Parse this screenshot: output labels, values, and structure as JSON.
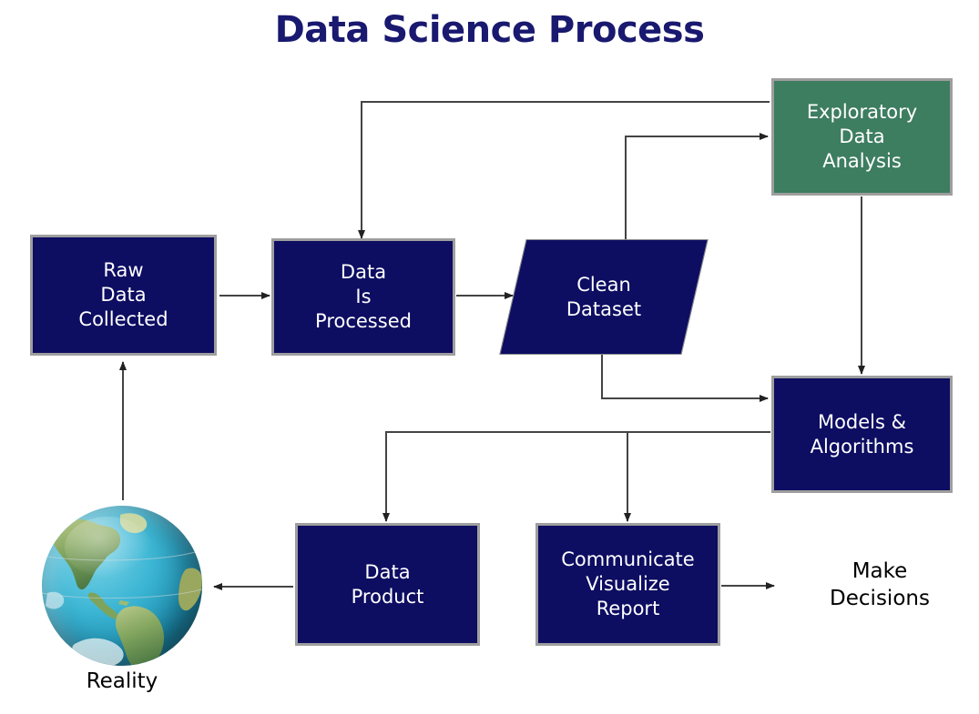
{
  "title": "Data Science Process",
  "colors": {
    "title": "#191970",
    "node_fill": "#0d0d62",
    "node_border": "#9e9e9e",
    "eda_fill": "#3d7d60",
    "text": "#ffffff",
    "plain_text": "#000000",
    "connector": "#333333",
    "background": "#ffffff"
  },
  "nodes": {
    "raw_data": {
      "lines": [
        "Raw",
        "Data",
        "Collected"
      ],
      "shape": "rectangle",
      "fill": "navy"
    },
    "data_processed": {
      "lines": [
        "Data",
        "Is",
        "Processed"
      ],
      "shape": "rectangle",
      "fill": "navy"
    },
    "clean_dataset": {
      "lines": [
        "Clean",
        "Dataset"
      ],
      "shape": "parallelogram",
      "fill": "navy"
    },
    "eda": {
      "lines": [
        "Exploratory",
        "Data",
        "Analysis"
      ],
      "shape": "rectangle",
      "fill": "green"
    },
    "models": {
      "lines": [
        "Models &",
        "Algorithms"
      ],
      "shape": "rectangle",
      "fill": "navy"
    },
    "data_product": {
      "lines": [
        "Data",
        "Product"
      ],
      "shape": "rectangle",
      "fill": "navy"
    },
    "communicate": {
      "lines": [
        "Communicate",
        "Visualize",
        "Report"
      ],
      "shape": "rectangle",
      "fill": "navy"
    },
    "make_decisions": {
      "lines": [
        "Make",
        "Decisions"
      ],
      "shape": "text",
      "fill": "none"
    },
    "reality": {
      "label": "Reality",
      "shape": "image",
      "icon": "globe-earth-icon"
    }
  },
  "edges": [
    {
      "from": "raw_data",
      "to": "data_processed",
      "label": ""
    },
    {
      "from": "data_processed",
      "to": "clean_dataset",
      "label": ""
    },
    {
      "from": "clean_dataset",
      "to": "eda",
      "label": ""
    },
    {
      "from": "eda",
      "to": "data_processed",
      "label": ""
    },
    {
      "from": "eda",
      "to": "models",
      "label": ""
    },
    {
      "from": "clean_dataset",
      "to": "models",
      "label": ""
    },
    {
      "from": "models",
      "to": "data_product",
      "label": ""
    },
    {
      "from": "models",
      "to": "communicate",
      "label": ""
    },
    {
      "from": "communicate",
      "to": "make_decisions",
      "label": ""
    },
    {
      "from": "data_product",
      "to": "reality",
      "label": ""
    },
    {
      "from": "reality",
      "to": "raw_data",
      "label": ""
    }
  ]
}
